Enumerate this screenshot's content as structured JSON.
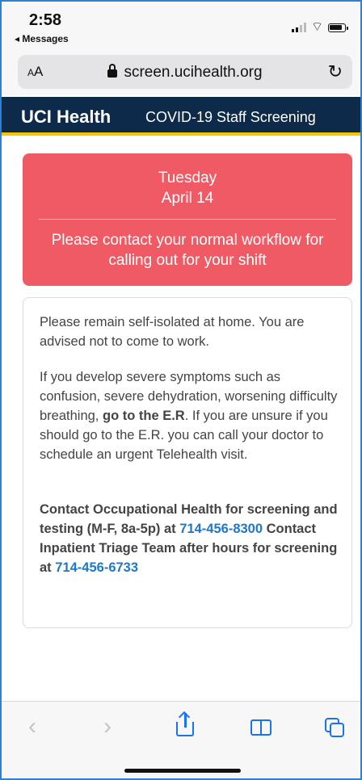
{
  "status_bar": {
    "time": "2:58",
    "back_app": "◂ Messages"
  },
  "browser": {
    "text_size_label": "AA",
    "url": "screen.ucihealth.org"
  },
  "header": {
    "brand": "UCI Health",
    "subtitle": "COVID-19 Staff Screening"
  },
  "alert": {
    "day": "Tuesday",
    "date": "April 14",
    "message": "Please contact your normal workflow for calling out for your shift"
  },
  "info": {
    "p1": "Please remain self-isolated at home. You are advised not to come to work.",
    "p2_part1": "If you develop severe symptoms such as confusion, severe dehydration, worsening difficulty breathing, ",
    "p2_bold": "go to the E.R",
    "p2_part2": ". If you are unsure if you should go to the E.R. you can call your doctor to schedule an urgent Telehealth visit.",
    "p3_part1": "Contact Occupational Health for screening and testing (M-F, 8a-5p) at ",
    "phone1": "714-456-8300",
    "p3_part2": " Contact Inpatient Triage Team after hours for screening at ",
    "phone2": "714-456-6733"
  },
  "colors": {
    "header_bg": "#0e2a4a",
    "header_accent": "#f6c500",
    "alert_bg": "#ef5a64",
    "link": "#1f77c8",
    "toolbar_active": "#1a73e8"
  },
  "toolbar": {
    "back": "‹",
    "forward": "›"
  }
}
